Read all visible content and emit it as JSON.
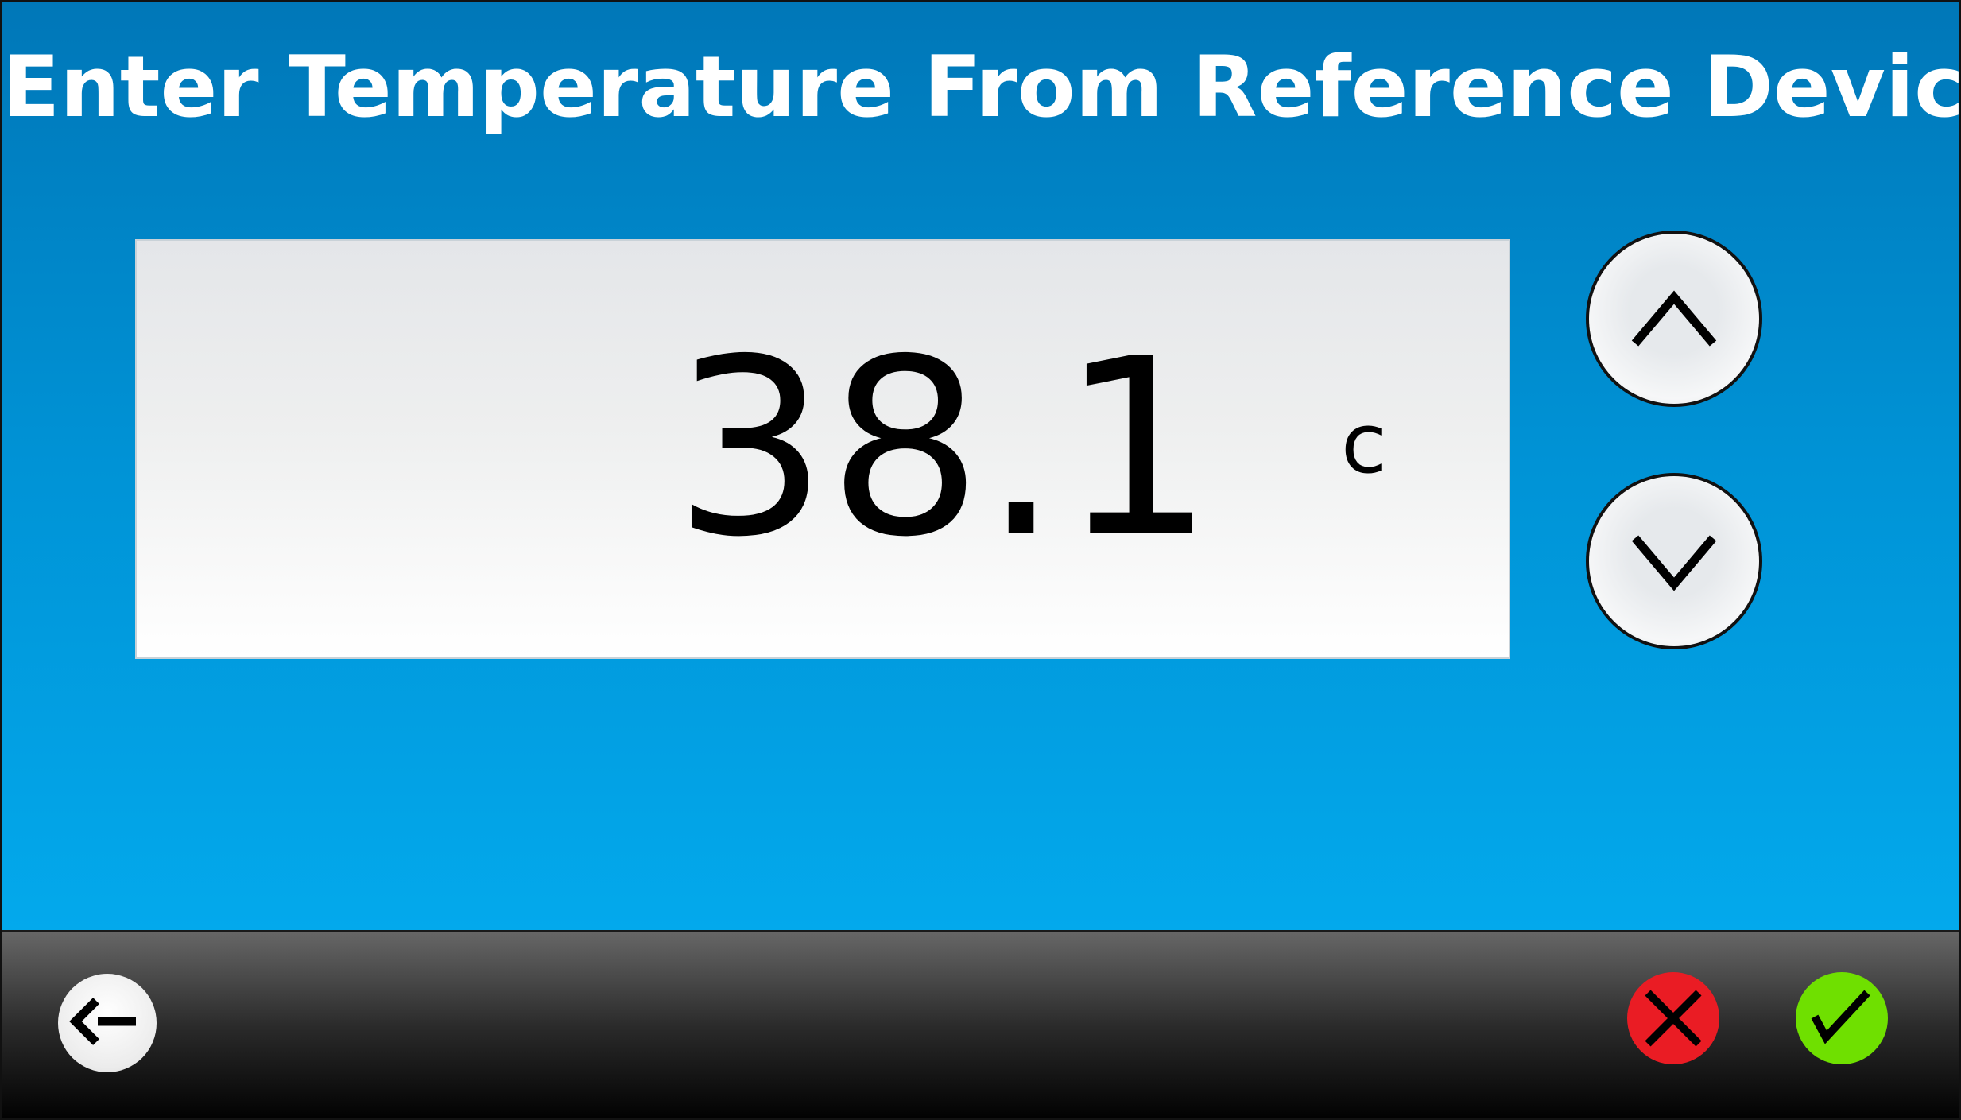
{
  "header": {
    "title": "Enter Temperature From Reference Device"
  },
  "reading": {
    "value": "38.1",
    "unit": "c"
  },
  "controls": {
    "increment_icon": "chevron-up-icon",
    "decrement_icon": "chevron-down-icon"
  },
  "footer": {
    "back_icon": "arrow-left-icon",
    "cancel_icon": "close-icon",
    "confirm_icon": "check-icon"
  },
  "colors": {
    "background_top": "#0077b8",
    "background_bottom": "#03a9ec",
    "footer_top": "#666666",
    "footer_bottom": "#000000",
    "cancel": "#ea1c24",
    "confirm": "#6fe000"
  }
}
